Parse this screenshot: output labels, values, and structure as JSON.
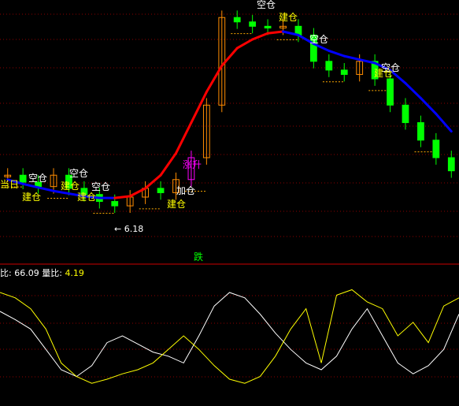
{
  "chart_data": [
    {
      "type": "candlestick",
      "panel": "main",
      "title": "",
      "xlabel": "",
      "ylabel": "",
      "grid": true,
      "annotations": {
        "signals": [
          "空仓",
          "空仓",
          "空仓",
          "空仓",
          "空仓",
          "空仓",
          "建仓",
          "建仓",
          "建仓",
          "建仓",
          "建仓",
          "建仓",
          "加仓",
          "涨升",
          "当日"
        ],
        "low_price_label": "← 6.18",
        "bottom_tag": "跌"
      },
      "series": [
        {
          "name": "MA-trend",
          "colors": {
            "falling": "#0000ff",
            "rising": "#ff0000"
          },
          "values": [
            6.55,
            6.5,
            6.46,
            6.42,
            6.39,
            6.36,
            6.34,
            6.34,
            6.36,
            6.45,
            6.6,
            6.85,
            7.2,
            7.55,
            7.85,
            8.05,
            8.15,
            8.22,
            8.24,
            8.2,
            8.1,
            8.02,
            7.96,
            7.92,
            7.88,
            7.8,
            7.65,
            7.48,
            7.3,
            7.1
          ]
        }
      ],
      "candles": {
        "close": [
          6.6,
          6.52,
          6.47,
          6.6,
          6.45,
          6.38,
          6.3,
          6.25,
          6.35,
          6.45,
          6.4,
          6.55,
          6.8,
          7.4,
          8.4,
          8.35,
          8.3,
          8.28,
          8.3,
          8.2,
          7.9,
          7.8,
          7.75,
          7.9,
          7.7,
          7.4,
          7.2,
          7.0,
          6.8,
          6.65
        ],
        "colors": {
          "up": "#ff8c00",
          "down": "#00ff00",
          "special": "#ff00ff"
        }
      }
    },
    {
      "type": "line",
      "panel": "indicator",
      "title": "",
      "readout": {
        "label1": "比:",
        "value1": "66.09",
        "label2": "量比:",
        "value2": "4.19"
      },
      "series": [
        {
          "name": "比",
          "color": "#ffffff",
          "values": [
            68,
            62,
            55,
            40,
            25,
            20,
            28,
            45,
            50,
            44,
            38,
            35,
            30,
            50,
            72,
            82,
            78,
            66,
            52,
            40,
            30,
            25,
            35,
            55,
            70,
            50,
            30,
            22,
            28,
            40,
            66
          ]
        },
        {
          "name": "量比",
          "color": "#ffff00",
          "values": [
            82,
            78,
            70,
            55,
            30,
            20,
            15,
            18,
            22,
            25,
            30,
            40,
            50,
            40,
            28,
            18,
            15,
            20,
            35,
            55,
            70,
            30,
            80,
            84,
            75,
            70,
            50,
            60,
            45,
            72,
            78
          ]
        }
      ]
    }
  ]
}
